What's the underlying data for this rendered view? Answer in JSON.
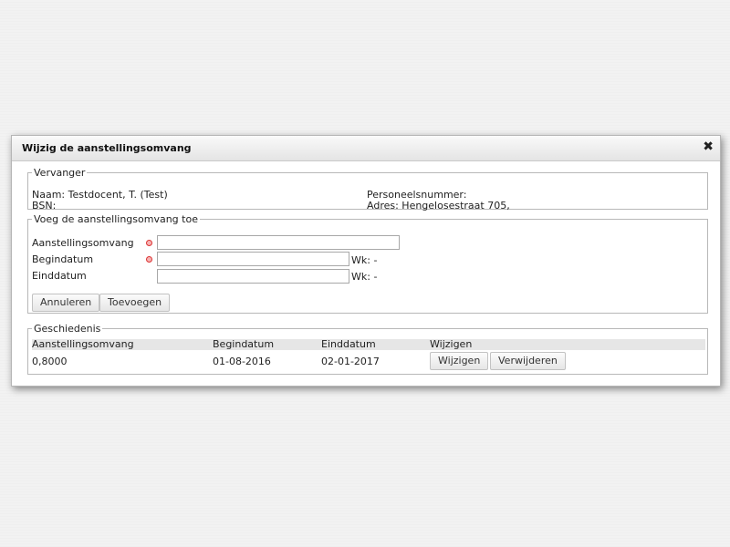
{
  "dialog": {
    "title": "Wijzig de aanstellingsomvang",
    "close_symbol": "✖"
  },
  "vervanger": {
    "legend": "Vervanger",
    "naam": "Naam: Testdocent, T. (Test)",
    "bsn": "BSN:",
    "personeelsnummer": "Personeelsnummer:",
    "adres": "Adres: Hengelosestraat 705,"
  },
  "form": {
    "legend": "Voeg de aanstellingsomvang toe",
    "aanstellingsomvang_label": "Aanstellingsomvang",
    "aanstellingsomvang_value": "",
    "begindatum_label": "Begindatum",
    "begindatum_value": "",
    "begindatum_wk": "Wk: -",
    "einddatum_label": "Einddatum",
    "einddatum_value": "",
    "einddatum_wk": "Wk: -",
    "cancel_label": "Annuleren",
    "add_label": "Toevoegen",
    "required_color": "#d33333"
  },
  "history": {
    "legend": "Geschiedenis",
    "headers": [
      "Aanstellingsomvang",
      "Begindatum",
      "Einddatum",
      "Wijzigen"
    ],
    "rows": [
      {
        "omvang": "0,8000",
        "begindatum": "01-08-2016",
        "einddatum": "02-01-2017",
        "edit_label": "Wijzigen",
        "delete_label": "Verwijderen"
      }
    ]
  }
}
